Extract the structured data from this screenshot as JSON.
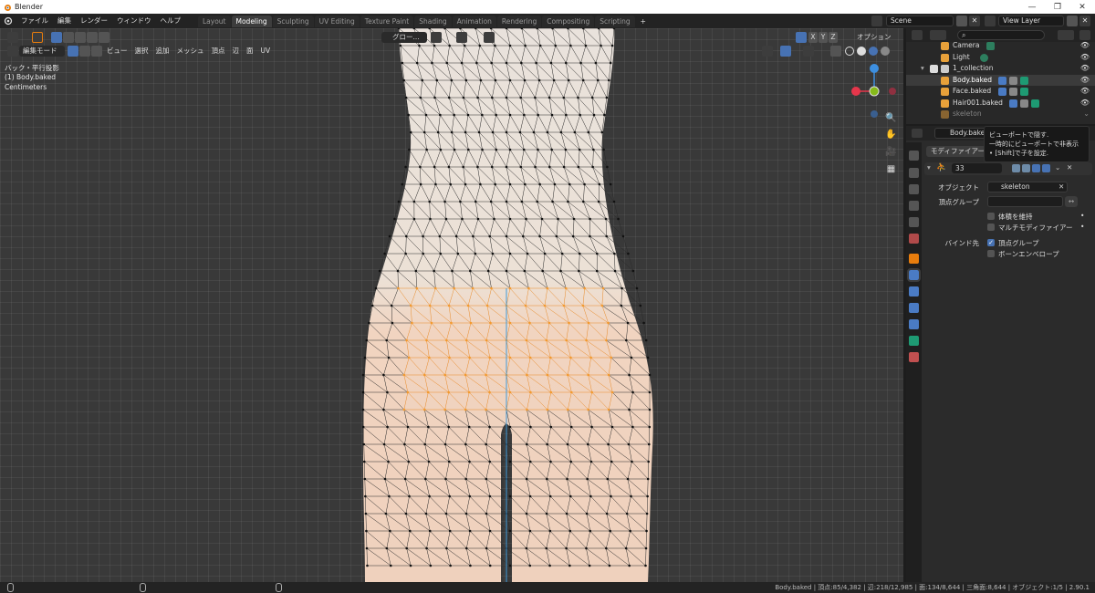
{
  "window": {
    "title": "Blender",
    "controls": [
      "—",
      "❐",
      "✕"
    ]
  },
  "menu": {
    "items": [
      "ファイル",
      "編集",
      "レンダー",
      "ウィンドウ",
      "ヘルプ"
    ]
  },
  "workspaces": {
    "tabs": [
      "Layout",
      "Modeling",
      "Sculpting",
      "UV Editing",
      "Texture Paint",
      "Shading",
      "Animation",
      "Rendering",
      "Compositing",
      "Scripting"
    ],
    "active": "Modeling",
    "add": "+"
  },
  "scene": {
    "name": "Scene"
  },
  "view_layer": {
    "name": "View Layer"
  },
  "viewport_header": {
    "mode": "編集モード",
    "menus": [
      "ビュー",
      "選択",
      "追加",
      "メッシュ",
      "頂点",
      "辺",
      "面",
      "UV"
    ],
    "transform_orientation": "グロー...",
    "xyz": [
      "X",
      "Y",
      "Z"
    ],
    "options": "オプション"
  },
  "viewport_info": {
    "view_name": "バック・平行投影",
    "object": "(1) Body.baked",
    "units": "Centimeters"
  },
  "gizmo": {
    "colors": {
      "x": "#e5364b",
      "y": "#86ba1a",
      "z": "#3d8fe0"
    }
  },
  "outliner": {
    "search_placeholder": "",
    "rows": [
      {
        "name": "Camera",
        "icon_color": "#e8a13a"
      },
      {
        "name": "Light",
        "icon_color": "#e8a13a"
      },
      {
        "name": "1_collection",
        "icon_color": "#cccccc"
      },
      {
        "name": "Body.baked",
        "icon_color": "#e8a13a"
      },
      {
        "name": "Face.baked",
        "icon_color": "#e8a13a"
      },
      {
        "name": "Hair001.baked",
        "icon_color": "#e8a13a"
      },
      {
        "name": "skeleton",
        "icon_color": "#e8a13a"
      }
    ]
  },
  "properties": {
    "object_name": "Body.baked",
    "add_modifier": "モディファイアー",
    "modifier_name": "33",
    "object_label": "オブジェクト",
    "object_value": "skeleton",
    "vertex_group_label": "頂点グループ",
    "preserve_volume": "体積を維持",
    "multi_modifier": "マルチモディファイアー",
    "bind_to_label": "バインド先",
    "bind_vertex_groups": "頂点グループ",
    "bind_bone_envelopes": "ボーンエンベロープ"
  },
  "tooltip": {
    "line1": "ビューポートで隠す.",
    "line2": "一時的にビューポートで非表示",
    "line3": "• [Shift]で子を設定."
  },
  "statusbar": {
    "text": "Body.baked | 頂点:85/4,382 | 辺:218/12,985 | 面:134/8,644 | 三角面:8,644 | オブジェクト:1/5 | 2.90.1"
  }
}
